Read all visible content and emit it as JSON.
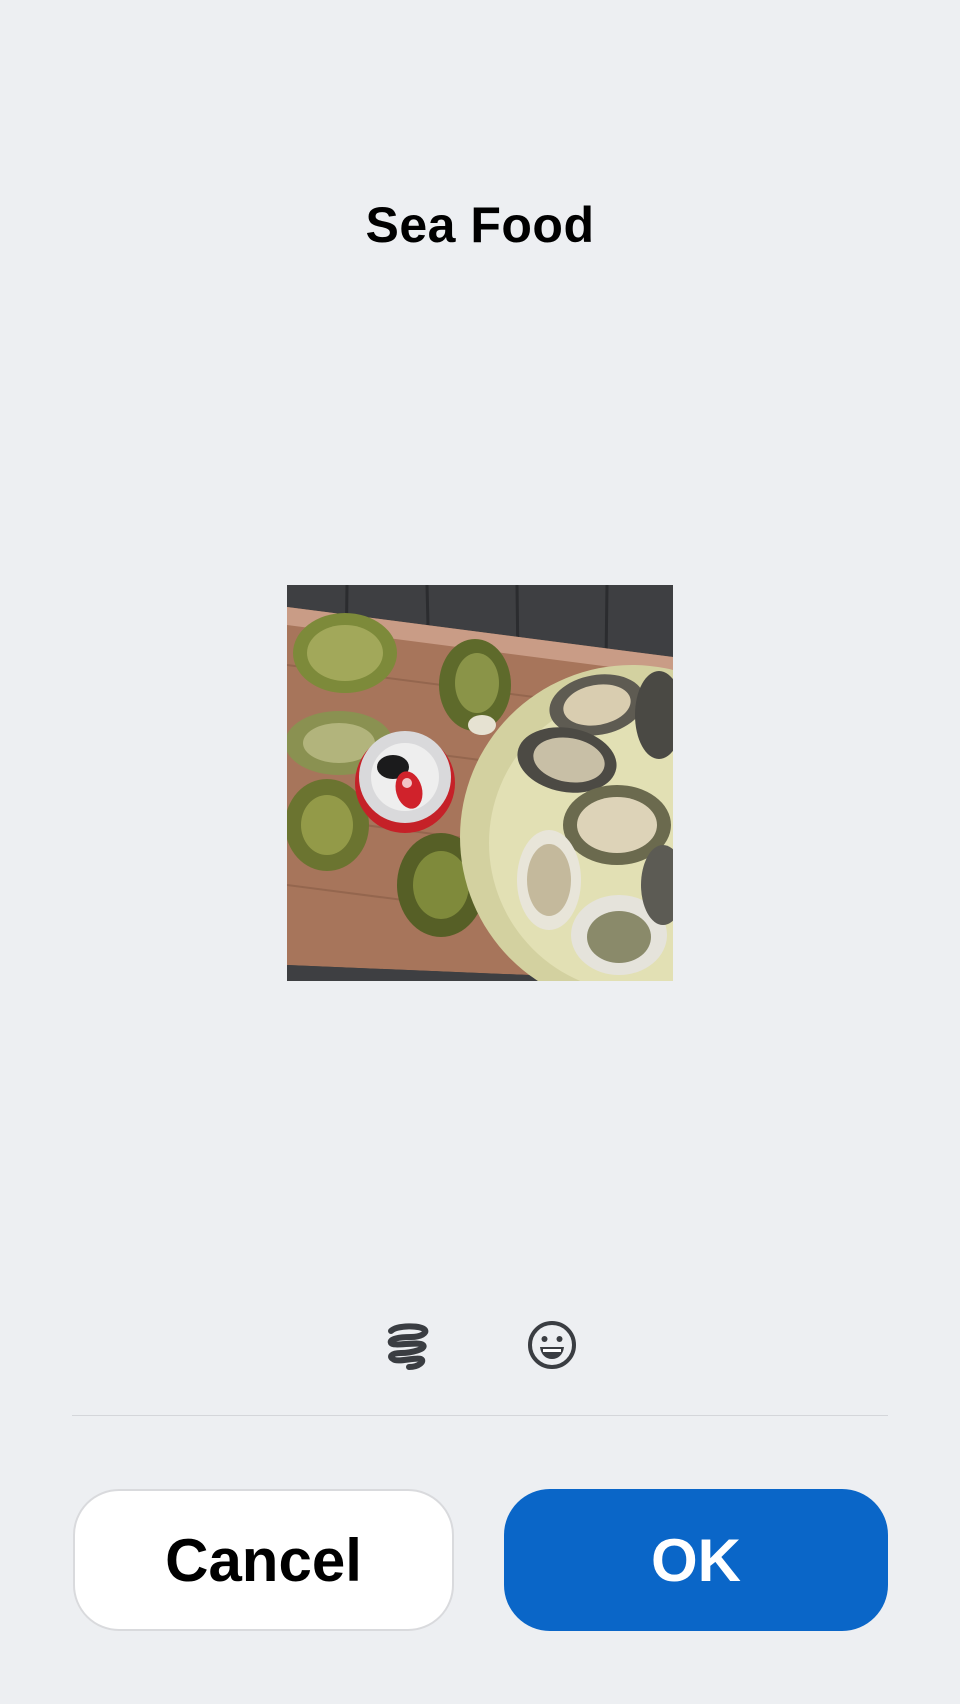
{
  "dialog": {
    "title": "Sea Food"
  },
  "toolbar": {
    "sticker_icon": "sticker-icon",
    "emoji_icon": "emoji-icon"
  },
  "actions": {
    "cancel_label": "Cancel",
    "ok_label": "OK"
  },
  "colors": {
    "background": "#edeff2",
    "primary": "#0a66c8",
    "icon": "#3a3d42"
  }
}
